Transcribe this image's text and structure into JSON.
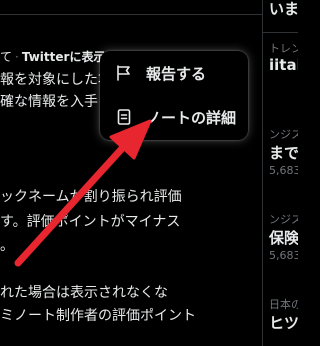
{
  "note": {
    "header": {
      "tail": "て",
      "separator": "·",
      "brand": "Twitterに表示"
    },
    "lines": [
      "報を対象にした場",
      "確な情報を入手",
      "ックネームが割り振られ評価",
      "す。評価ポイントがマイナス",
      "。",
      "れた場合は表示されなくな",
      "ミノート制作者の評価ポイント"
    ]
  },
  "menu": {
    "items": [
      {
        "label": "報告する",
        "icon": "flag-icon"
      },
      {
        "label": "ノートの詳細",
        "icon": "document-icon"
      }
    ]
  },
  "annotation": {
    "arrow_color": "#e8262f",
    "icon": "red-arrow"
  },
  "sidebar": {
    "items": [
      {
        "text": "いま",
        "style": "big"
      },
      {
        "text": "トレン",
        "style": "small"
      },
      {
        "text": "iitai",
        "style": "big"
      },
      {
        "text": "ンジス",
        "style": "small"
      },
      {
        "text": "まで",
        "style": "big"
      },
      {
        "text": "5,683",
        "style": "small"
      },
      {
        "text": "ンジス",
        "style": "small"
      },
      {
        "text": "保険",
        "style": "big"
      },
      {
        "text": "5,683",
        "style": "small"
      },
      {
        "text": "日本の",
        "style": "small"
      },
      {
        "text": "ヒツ",
        "style": "big"
      }
    ]
  },
  "colors": {
    "background": "#000000",
    "text": "#e7e9ea",
    "muted": "#71767b",
    "border": "#2f3336"
  }
}
